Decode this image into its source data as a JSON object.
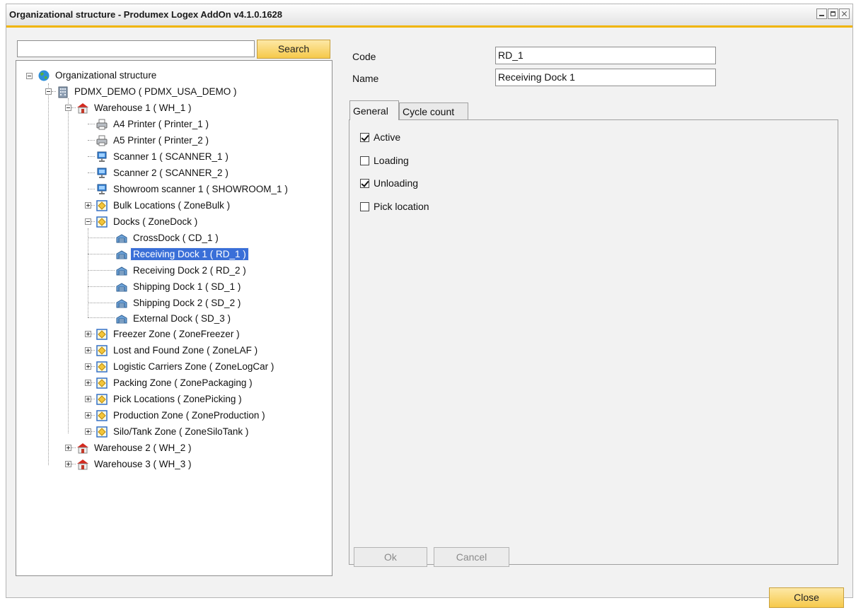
{
  "window": {
    "title": "Organizational structure - Produmex Logex AddOn v4.1.0.1628"
  },
  "search": {
    "value": "",
    "button_label": "Search"
  },
  "tree": {
    "root": "Organizational structure",
    "company": "PDMX_DEMO ( PDMX_USA_DEMO )",
    "warehouse1": "Warehouse 1 ( WH_1 )",
    "items": [
      {
        "label": "A4 Printer ( Printer_1 )",
        "icon": "printer-icon"
      },
      {
        "label": "A5 Printer ( Printer_2 )",
        "icon": "printer-icon"
      },
      {
        "label": "Scanner 1 ( SCANNER_1 )",
        "icon": "scanner-icon"
      },
      {
        "label": "Scanner 2 ( SCANNER_2 )",
        "icon": "scanner-icon"
      },
      {
        "label": "Showroom scanner 1 ( SHOWROOM_1 )",
        "icon": "scanner-icon"
      }
    ],
    "bulk_zone": "Bulk Locations ( ZoneBulk )",
    "docks_zone": "Docks ( ZoneDock )",
    "docks": [
      {
        "label": "CrossDock ( CD_1 )"
      },
      {
        "label": "Receiving Dock 1 ( RD_1 )"
      },
      {
        "label": "Receiving Dock 2 ( RD_2 )"
      },
      {
        "label": "Shipping Dock 1 ( SD_1 )"
      },
      {
        "label": "Shipping Dock 2 ( SD_2 )"
      },
      {
        "label": "External Dock ( SD_3 )"
      }
    ],
    "zones": [
      {
        "label": "Freezer Zone ( ZoneFreezer )"
      },
      {
        "label": "Lost and Found Zone ( ZoneLAF )"
      },
      {
        "label": "Logistic Carriers Zone ( ZoneLogCar )"
      },
      {
        "label": "Packing Zone ( ZonePackaging )"
      },
      {
        "label": "Pick Locations ( ZonePicking )"
      },
      {
        "label": "Production Zone ( ZoneProduction )"
      },
      {
        "label": "Silo/Tank Zone ( ZoneSiloTank )"
      }
    ],
    "warehouse2": "Warehouse 2 ( WH_2 )",
    "warehouse3": "Warehouse 3 ( WH_3 )",
    "selected": "Receiving Dock 1 ( RD_1 )"
  },
  "details": {
    "code_label": "Code",
    "code_value": "RD_1",
    "name_label": "Name",
    "name_value": "Receiving Dock 1"
  },
  "tabs": [
    {
      "label": "General",
      "active": true
    },
    {
      "label": "Cycle count",
      "active": false
    }
  ],
  "checkboxes": [
    {
      "label": "Active",
      "checked": true
    },
    {
      "label": "Loading",
      "checked": false
    },
    {
      "label": "Unloading",
      "checked": true
    },
    {
      "label": "Pick location",
      "checked": false
    }
  ],
  "buttons": {
    "ok": "Ok",
    "cancel": "Cancel",
    "close": "Close"
  },
  "colors": {
    "accent": "#f0b400",
    "selection": "#3a6fd8",
    "button_yellow": "#f6c94a"
  }
}
